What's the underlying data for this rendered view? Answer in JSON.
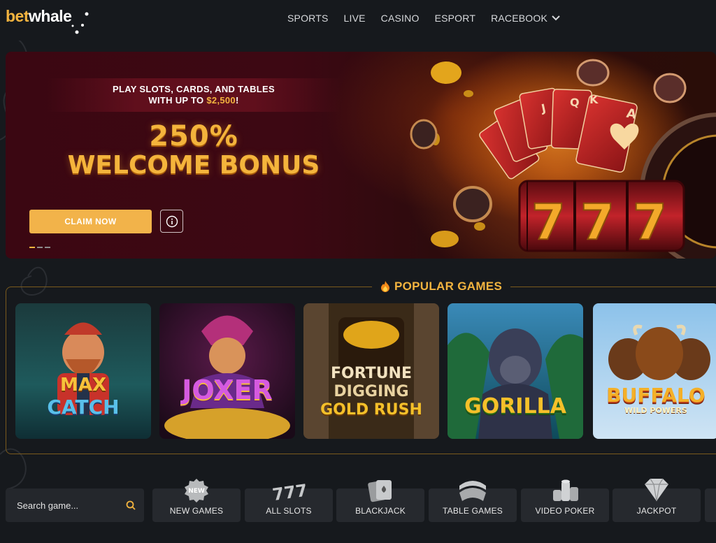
{
  "brand": {
    "logo_bet": "bet",
    "logo_whale": "whale"
  },
  "nav": {
    "items": [
      {
        "label": "SPORTS"
      },
      {
        "label": "LIVE"
      },
      {
        "label": "CASINO"
      },
      {
        "label": "ESPORT"
      },
      {
        "label": "RACEBOOK"
      }
    ]
  },
  "hero": {
    "sub_line1": "PLAY SLOTS, CARDS, AND TABLES",
    "sub_line2_prefix": "WITH UP TO ",
    "sub_amount": "$2,500",
    "sub_line2_suffix": "!",
    "percent": "250%",
    "title": "WELCOME BONUS",
    "cta_label": "CLAIM NOW",
    "slide_count": 3,
    "active_slide": 1
  },
  "popular": {
    "title": "POPULAR GAMES",
    "games": [
      {
        "name_line1": "MAX",
        "name_line2": "CATCH"
      },
      {
        "name_line1": "JOXER",
        "name_line2": ""
      },
      {
        "name_line1": "FORTUNE",
        "name_line2": "DIGGING",
        "name_line3": "GOLD RUSH"
      },
      {
        "name_line1": "GORILLA",
        "name_line2": ""
      },
      {
        "name_line1": "BUFFALO",
        "name_line2": "WILD POWERS"
      }
    ]
  },
  "search": {
    "placeholder": "Search game..."
  },
  "categories": [
    {
      "label": "NEW GAMES",
      "badge": "NEW"
    },
    {
      "label": "ALL SLOTS"
    },
    {
      "label": "BLACKJACK"
    },
    {
      "label": "TABLE GAMES"
    },
    {
      "label": "VIDEO POKER"
    },
    {
      "label": "JACKPOT"
    }
  ],
  "colors": {
    "accent": "#f3b43f",
    "background": "#16191d",
    "card": "#26292e"
  }
}
